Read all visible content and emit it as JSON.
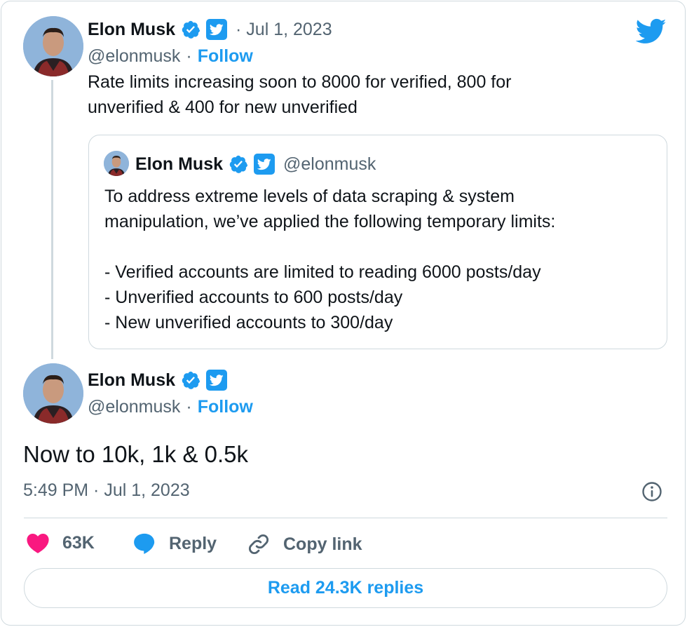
{
  "tweet1": {
    "name": "Elon Musk",
    "date": "· Jul 1, 2023",
    "handle": "@elonmusk",
    "separator": "·",
    "follow_label": "Follow",
    "text": "Rate limits increasing soon to 8000 for verified, 800 for\nunverified & 400 for new unverified"
  },
  "quote": {
    "name": "Elon Musk",
    "handle": "@elonmusk",
    "text": "To address extreme levels of data scraping & system\nmanipulation, we’ve applied the following temporary limits:\n\n- Verified accounts are limited to reading 6000 posts/day\n- Unverified accounts to 600 posts/day\n- New unverified accounts to 300/day"
  },
  "tweet2": {
    "name": "Elon Musk",
    "handle": "@elonmusk",
    "separator": "·",
    "follow_label": "Follow",
    "text": "Now to 10k, 1k & 0.5k",
    "timestamp": "5:49 PM · Jul 1, 2023"
  },
  "actions": {
    "likes": "63K",
    "reply_label": "Reply",
    "copy_link_label": "Copy link"
  },
  "read_replies_label": "Read 24.3K replies",
  "colors": {
    "accent": "#1d9bf0",
    "heart": "#f91880",
    "text": "#0f1419",
    "muted": "#536471",
    "border": "#cfd9de"
  },
  "icons": {
    "logo": "twitter-bird-icon",
    "verified": "verified-badge-icon",
    "affiliate": "twitter-affiliate-badge-icon",
    "info": "info-icon",
    "like": "heart-icon",
    "reply": "speech-bubble-icon",
    "copy_link": "link-icon"
  }
}
